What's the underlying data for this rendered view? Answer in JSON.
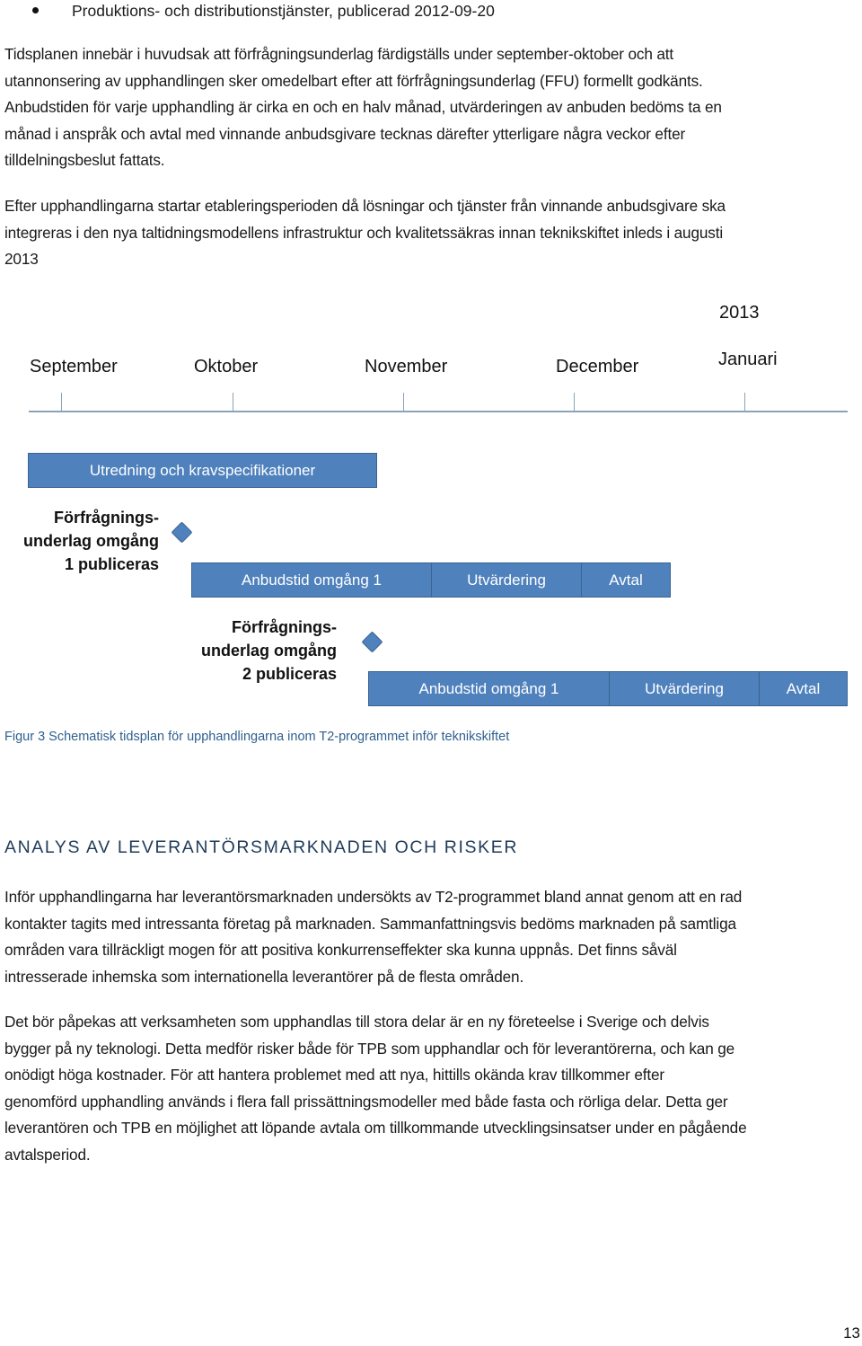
{
  "bullet": {
    "text": "Produktions- och distributionstjänster, publicerad 2012-09-20"
  },
  "paragraph1": {
    "lines": [
      "Tidsplanen innebär i huvudsak att förfrågningsunderlag färdigställs under september-oktober och att",
      "utannonsering av upphandlingen sker omedelbart efter att förfrågningsunderlag (FFU) formellt godkänts.",
      "Anbudstiden för varje upphandling är cirka en och en halv månad, utvärderingen av anbuden bedöms ta en",
      "månad i anspråk och avtal med vinnande anbudsgivare tecknas därefter ytterligare några veckor efter",
      "tilldelningsbeslut fattats."
    ]
  },
  "paragraph2": {
    "lines": [
      "Efter upphandlingarna startar etableringsperioden då lösningar och tjänster från vinnande anbudsgivare ska",
      "integreras i den nya taltidningsmodellens infrastruktur och kvalitetssäkras innan teknikskiftet inleds i augusti",
      "2013"
    ]
  },
  "timeline": {
    "year_label": "2013",
    "months": [
      "September",
      "Oktober",
      "November",
      "December",
      "Januari"
    ],
    "bar_color": "#4f81bd",
    "phase1": {
      "label": "Utredning och kravspecifikationer"
    },
    "milestone1": {
      "lines": [
        "Förfrågnings-",
        "underlag omgång",
        "1 publiceras"
      ]
    },
    "round1": {
      "segments": [
        "Anbudstid omgång 1",
        "Utvärdering",
        "Avtal"
      ]
    },
    "milestone2": {
      "lines": [
        "Förfrågnings-",
        "underlag omgång",
        "2 publiceras"
      ]
    },
    "round2": {
      "segments": [
        "Anbudstid omgång 1",
        "Utvärdering",
        "Avtal"
      ]
    }
  },
  "caption": "Figur 3 Schematisk tidsplan för upphandlingarna inom T2-programmet inför teknikskiftet",
  "section_heading": "ANALYS AV LEVERANTÖRSMARKNADEN OCH RISKER",
  "paragraph3": {
    "lines": [
      "Inför upphandlingarna har leverantörsmarknaden undersökts av T2-programmet bland annat genom att en rad",
      "kontakter tagits med intressanta företag på marknaden. Sammanfattningsvis bedöms marknaden på samtliga",
      "områden vara tillräckligt mogen för att positiva konkurrenseffekter ska kunna uppnås. Det finns såväl",
      "intresserade inhemska som internationella leverantörer på de flesta områden."
    ]
  },
  "paragraph4": {
    "lines": [
      "Det bör påpekas att verksamheten som upphandlas till stora delar är en ny företeelse i Sverige och delvis",
      "bygger på ny teknologi. Detta medför risker både för TPB som upphandlar och för leverantörerna, och kan ge",
      "onödigt höga kostnader. För att hantera problemet med att nya, hittills okända krav tillkommer efter",
      "genomförd upphandling används i flera fall prissättningsmodeller med både fasta och rörliga delar. Detta ger",
      "leverantören och TPB en möjlighet att löpande avtala om tillkommande utvecklingsinsatser under en pågående",
      "avtalsperiod."
    ]
  },
  "page_number": "13"
}
